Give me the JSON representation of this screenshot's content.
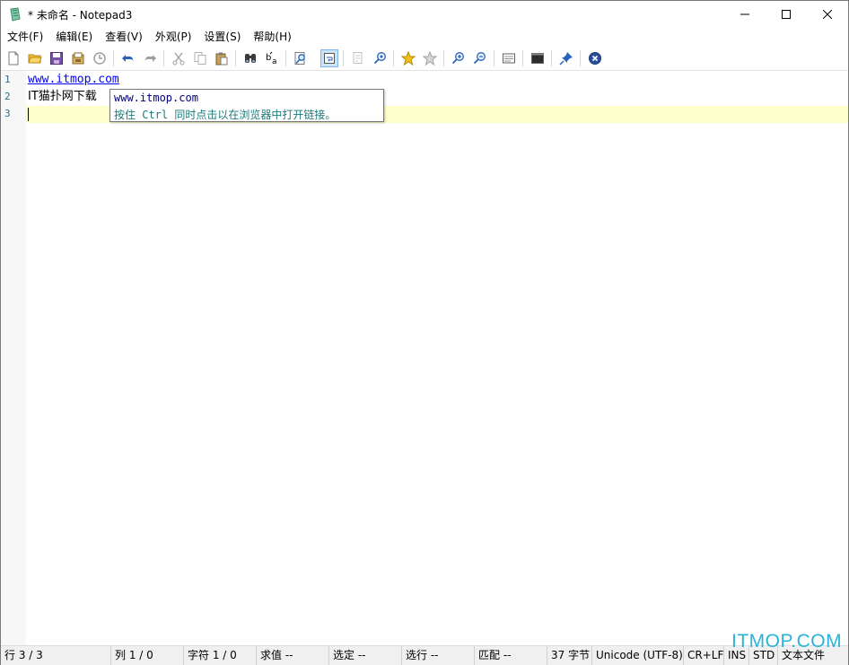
{
  "window": {
    "title": "* 未命名 - Notepad3"
  },
  "menu": [
    "文件(F)",
    "编辑(E)",
    "查看(V)",
    "外观(P)",
    "设置(S)",
    "帮助(H)"
  ],
  "toolbar": {
    "icons": [
      "new-file-icon",
      "open-folder-icon",
      "save-icon",
      "save-as-icon",
      "revert-icon",
      "undo-icon",
      "redo-icon",
      "cut-icon",
      "copy-icon",
      "paste-icon",
      "find-icon",
      "replace-icon",
      "find-in-files-icon",
      "word-wrap-icon",
      "monitor-changes-icon",
      "view-zoom-icon",
      "bookmark-icon",
      "clear-bookmarks-icon",
      "zoom-in-icon",
      "zoom-out-icon",
      "view-options-icon",
      "terminal-icon",
      "pin-icon",
      "close-icon"
    ]
  },
  "editor": {
    "line_numbers": [
      "1",
      "2",
      "3"
    ],
    "lines": [
      "www.itmop.com",
      "IT猫扑网下载",
      ""
    ]
  },
  "tooltip": {
    "url": "www.itmop.com",
    "hint": "按住 Ctrl 同时点击以在浏览器中打开链接。"
  },
  "status": {
    "line": "行 3 / 3",
    "col": "列 1 / 0",
    "char": "字符 1 / 0",
    "sum": "求值 --",
    "sel": "选定 --",
    "sel_lines": "选行 --",
    "match": "匹配 --",
    "bytes": "37 字节",
    "encoding": "Unicode (UTF-8)",
    "eol": "CR+LF",
    "ovr": "INS",
    "mode": "STD",
    "lexer": "文本文件"
  },
  "watermark": "ITMOP.COM",
  "colors": {
    "accent": "#0078d7",
    "current_line": "#ffffcc",
    "link": "#0000ff"
  }
}
